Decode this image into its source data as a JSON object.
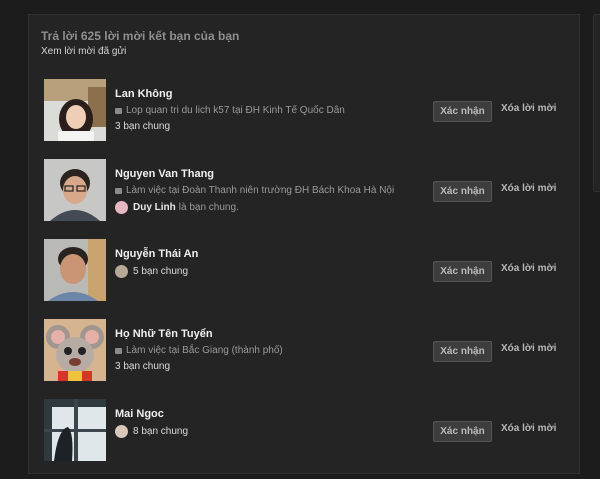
{
  "header": {
    "title": "Trả lời 625 lời mời kết bạn của bạn",
    "sent_link": "Xem lời mời đã gửi"
  },
  "buttons": {
    "confirm": "Xác nhận",
    "delete": "Xóa lời mời"
  },
  "requests": [
    {
      "name": "Lan Không",
      "info": "Lop quan tri du lich k57 tại ĐH Kinh Tế Quốc Dân",
      "mutual": "3 bạn chung"
    },
    {
      "name": "Nguyen Van Thang",
      "info": "Làm việc tại Đoàn Thanh niên trường ĐH Bách Khoa Hà Nội",
      "mutual_friend": "Duy Linh",
      "mutual_suffix": "là bạn chung."
    },
    {
      "name": "Nguyễn Thái An",
      "mutual": "5 bạn chung"
    },
    {
      "name": "Họ Nhữ Tên Tuyển",
      "info": "Làm việc tại Bắc Giang (thành phố)",
      "mutual": "3 bạn chung"
    },
    {
      "name": "Mai Ngoc",
      "mutual": "8 bạn chung"
    }
  ],
  "icons": {
    "work": "briefcase-icon"
  }
}
